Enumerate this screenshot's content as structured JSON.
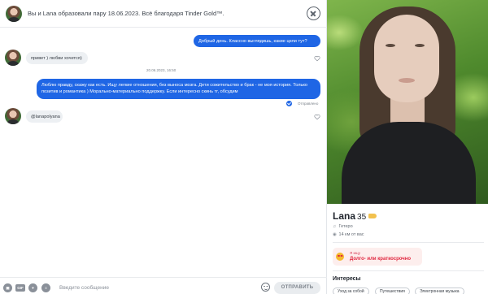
{
  "header": {
    "match_text": "Вы и Lana образовали пару 18.06.2023. Всё благодаря Tinder Gold™."
  },
  "messages": [
    {
      "direction": "out",
      "text": "Добрый день. Классно выглядишь, какие цели тут?"
    },
    {
      "direction": "in",
      "text": "привет ) любви хочется)"
    },
    {
      "direction": "out",
      "text": "Люблю правду, скажу как есть. Ищу легкие отношения, без выноса мозга. Дети сожительство и брак - не моя история. Только позитив и романтика ) Морально-материально поддержку. Если интересно скинь тг, обсудим"
    },
    {
      "direction": "in",
      "text": "@lanapolyana"
    }
  ],
  "timestamp": "20.06.2023, 16:50",
  "sent_status": "Отправлено",
  "composer": {
    "gif_label": "GIF",
    "placeholder": "Введите сообщение",
    "send_label": "ОТПРАВИТЬ"
  },
  "profile": {
    "name": "Lana",
    "age": "35",
    "orientation": "Гетеро",
    "distance": "14 км от вас",
    "seeking_label": "Я ищу",
    "seeking_value": "Долго- или краткосрочно",
    "interests_title": "Интересы",
    "interests": [
      "Уход за собой",
      "Путешествия",
      "Электронная музыка"
    ]
  },
  "colors": {
    "accent_blue": "#1f66e5",
    "incoming_bubble": "#edf0f3",
    "seeking_red": "#e0243d"
  },
  "icons": [
    "close-icon",
    "heart-icon",
    "sent-check-icon",
    "image-icon",
    "gif-icon",
    "sticker-icon",
    "music-icon",
    "emoji-icon",
    "verified-icon",
    "orientation-icon",
    "location-icon"
  ]
}
